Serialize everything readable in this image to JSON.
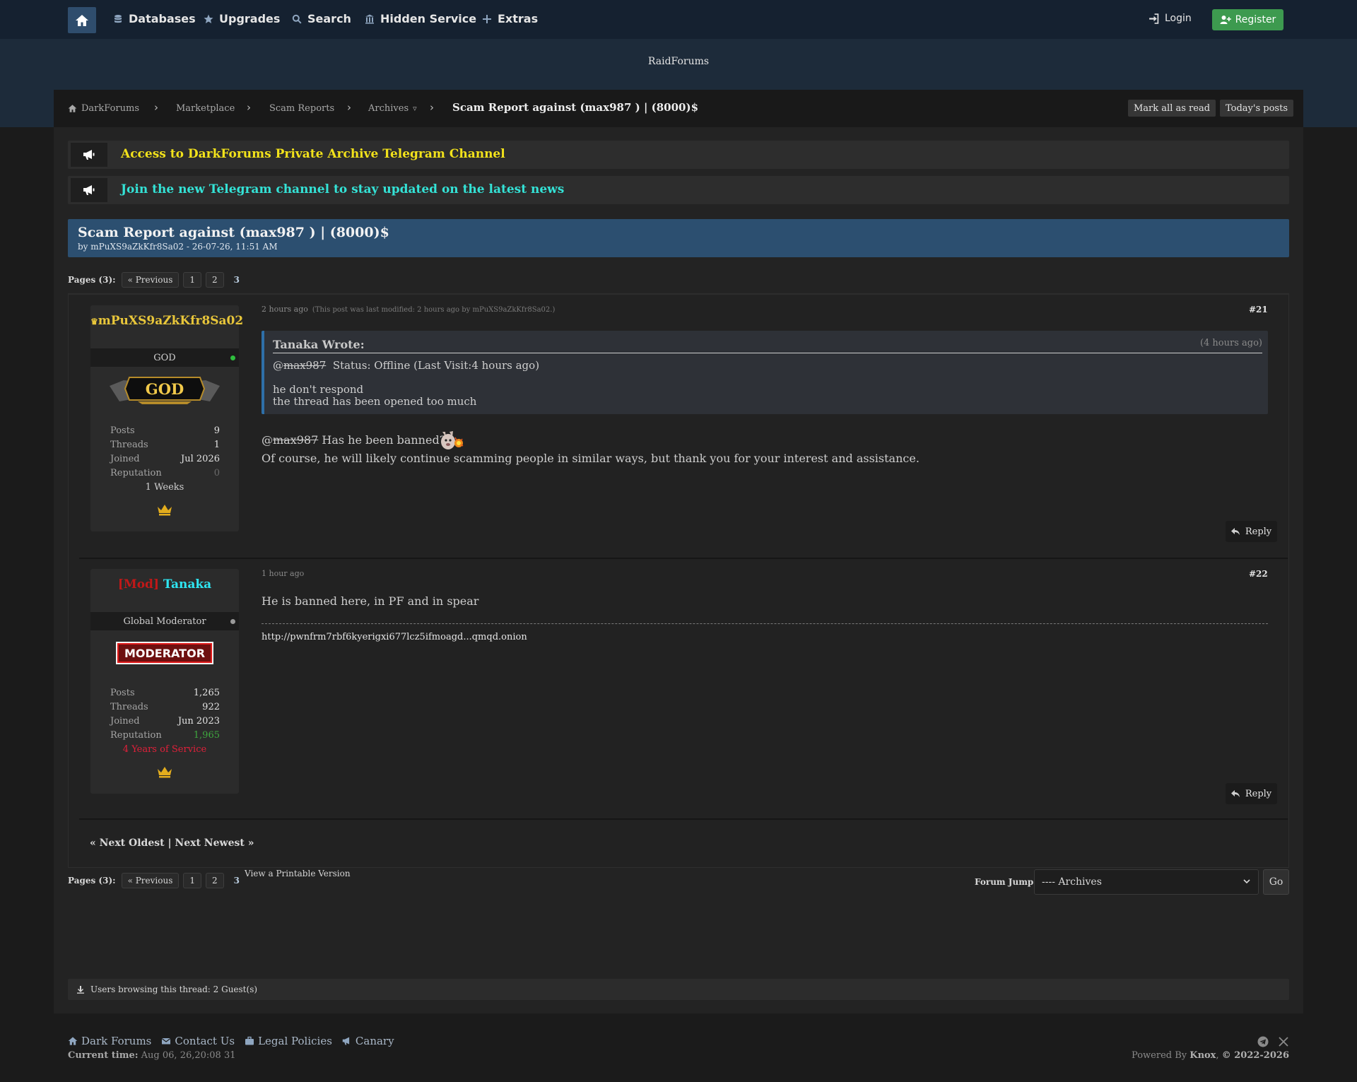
{
  "nav": {
    "items": [
      "Databases",
      "Upgrades",
      "Search",
      "Hidden Service",
      "Extras"
    ],
    "login": "Login",
    "register": "Register"
  },
  "site_name": "RaidForums",
  "breadcrumb": {
    "items": [
      "DarkForums",
      "Marketplace",
      "Scam Reports",
      "Archives"
    ],
    "archives_caret": "▿",
    "current": "Scam Report against (max987 ) | (8000)$",
    "mark_read": "Mark all as read",
    "todays_posts": "Today's posts"
  },
  "announcements": [
    {
      "text": "Access to DarkForums Private Archive Telegram Channel",
      "color": "#f2e21b"
    },
    {
      "text": "Join the new Telegram channel to stay updated on the latest news",
      "color": "#34e2d6"
    }
  ],
  "thread": {
    "title": "Scam Report against (max987 ) | (8000)$",
    "meta": "by mPuXS9aZkKfr8Sa02 - 26-07-26, 11:51 AM"
  },
  "pagination": {
    "label": "Pages (3):",
    "prev": "« Previous",
    "pages": [
      "1",
      "2",
      "3"
    ]
  },
  "posts": [
    {
      "username": "mPuXS9aZkKfr8Sa02",
      "rank": "GOD",
      "badge_text": "GOD",
      "stats": [
        {
          "k": "Posts",
          "v": "9"
        },
        {
          "k": "Threads",
          "v": "1"
        },
        {
          "k": "Joined",
          "v": "Jul 2026"
        },
        {
          "k": "Reputation",
          "v": "0"
        }
      ],
      "tenure": "1 Weeks",
      "time": "2 hours ago",
      "modified": "(This post was last modified: 2 hours ago by mPuXS9aZkKfr8Sa02.)",
      "number": "#21",
      "quote": {
        "author": "Tanaka Wrote:",
        "time": "(4 hours ago)",
        "at": "@",
        "user": "max987",
        "status": "Status: Offline (Last Visit:4 hours ago)",
        "line1": "he don't respond",
        "line2": "the thread has been opened too much"
      },
      "body_at": "@",
      "body_user": "max987",
      "body_q": "Has he been banned?",
      "body_line2": "Of course, he will likely continue scamming people in similar ways, but thank you for your interest and assistance.",
      "reply": "Reply"
    },
    {
      "username_prefix": "[Mod]",
      "username": "Tanaka",
      "rank": "Global Moderator",
      "badge_text": "MODERATOR",
      "stats": [
        {
          "k": "Posts",
          "v": "1,265"
        },
        {
          "k": "Threads",
          "v": "922"
        },
        {
          "k": "Joined",
          "v": "Jun 2023"
        },
        {
          "k": "Reputation",
          "v": "1,965"
        }
      ],
      "tenure": "4 Years of Service",
      "time": "1 hour ago",
      "number": "#22",
      "body": "He is banned here, in PF and in spear",
      "signature": "http://pwnfrm7rbf6kyerigxi677lcz5ifmoagd...qmqd.onion",
      "reply": "Reply"
    }
  ],
  "next_links": "« Next Oldest | Next Newest »",
  "printable": "View a Printable Version",
  "forum_jump": {
    "label": "Forum Jump:",
    "selected": "---- Archives",
    "go": "Go"
  },
  "browsing": "Users browsing this thread: 2 Guest(s)",
  "footer": {
    "links": [
      "Dark Forums",
      "Contact Us",
      "Legal Policies",
      "Canary"
    ],
    "current_time_label": "Current time:",
    "current_time": "Aug 06, 26,20:08 31",
    "powered_prefix": "Powered By",
    "powered_name": "Knox",
    "copyright": "© 2022-2026"
  },
  "colors": {
    "god_name": "#e8c63a",
    "mod_prefix": "#c01818",
    "mod_name": "#2ee6f2",
    "online": "#2fbf3e",
    "offline": "#9a9a9a",
    "rep_positive": "#3fa83f",
    "service": "#e0203a"
  }
}
